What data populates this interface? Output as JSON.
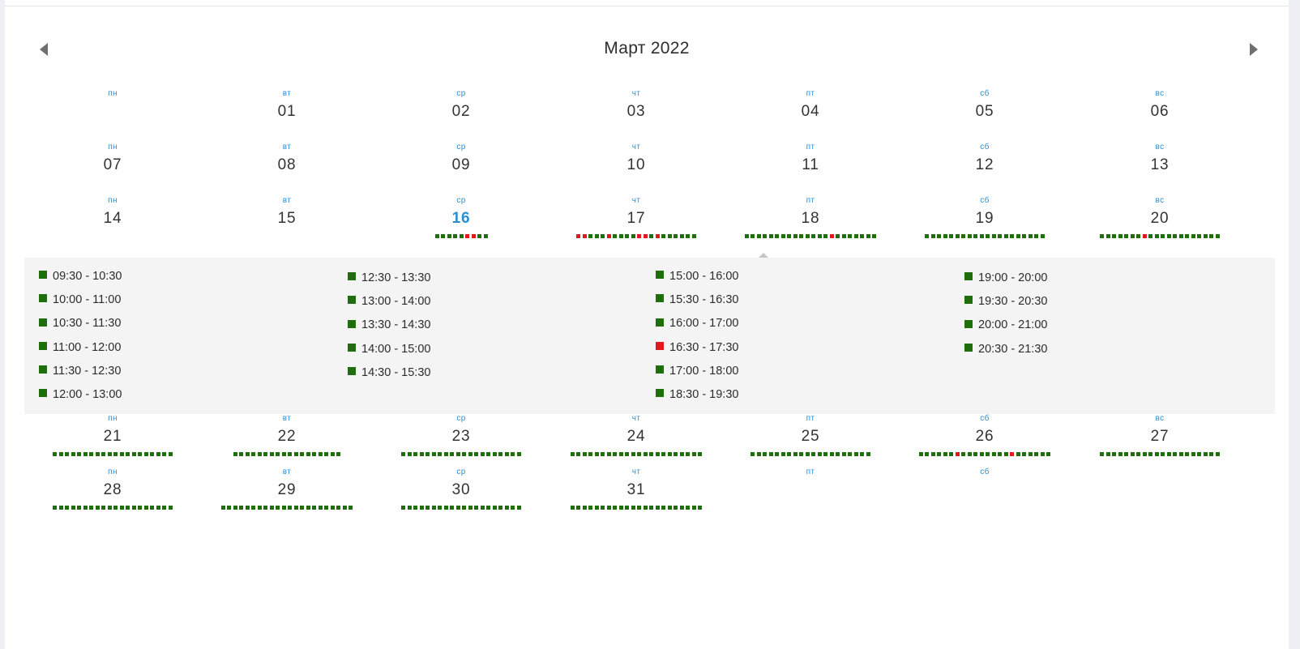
{
  "calendar": {
    "title": "Март 2022",
    "prev_icon": "triangle-left-icon",
    "next_icon": "triangle-right-icon",
    "colors": {
      "available": "#1f6e0c",
      "booked": "#e3181d",
      "weekday": "#2a8ed0",
      "today": "#2a8ed0"
    },
    "weeks": [
      [
        {
          "wd": "пн",
          "day": ""
        },
        {
          "wd": "вт",
          "day": "01"
        },
        {
          "wd": "ср",
          "day": "02"
        },
        {
          "wd": "чт",
          "day": "03"
        },
        {
          "wd": "пт",
          "day": "04"
        },
        {
          "wd": "сб",
          "day": "05"
        },
        {
          "wd": "вс",
          "day": "06"
        }
      ],
      [
        {
          "wd": "пн",
          "day": "07"
        },
        {
          "wd": "вт",
          "day": "08"
        },
        {
          "wd": "ср",
          "day": "09"
        },
        {
          "wd": "чт",
          "day": "10"
        },
        {
          "wd": "пт",
          "day": "11"
        },
        {
          "wd": "сб",
          "day": "12"
        },
        {
          "wd": "вс",
          "day": "13"
        }
      ],
      [
        {
          "wd": "пн",
          "day": "14"
        },
        {
          "wd": "вт",
          "day": "15"
        },
        {
          "wd": "ср",
          "day": "16",
          "today": true,
          "dots": "gggggrrgg"
        },
        {
          "wd": "чт",
          "day": "17",
          "dots": "rrgggrggggrrgrgggggg"
        },
        {
          "wd": "пт",
          "day": "18",
          "dots": "ggggggggggggggrggggggg"
        },
        {
          "wd": "сб",
          "day": "19",
          "dots": "gggggggggggggggggggg"
        },
        {
          "wd": "вс",
          "day": "20",
          "dots": "gggggggrgggggggggggg"
        }
      ],
      [
        {
          "wd": "пн",
          "day": "21",
          "dots": "gggggggggggggggggggg"
        },
        {
          "wd": "вт",
          "day": "22",
          "dots": "gggggggggggggggggg"
        },
        {
          "wd": "ср",
          "day": "23",
          "dots": "gggggggggggggggggggg"
        },
        {
          "wd": "чт",
          "day": "24",
          "dots": "gggggggggggggggggggggg"
        },
        {
          "wd": "пт",
          "day": "25",
          "dots": "gggggggggggggggggggg"
        },
        {
          "wd": "сб",
          "day": "26",
          "dots": "ggggggrggggggggrgggggg"
        },
        {
          "wd": "вс",
          "day": "27",
          "dots": "gggggggggggggggggggg"
        }
      ],
      [
        {
          "wd": "пн",
          "day": "28",
          "dots": "gggggggggggggggggggg"
        },
        {
          "wd": "вт",
          "day": "29",
          "dots": "gggggggggggggggggggggg"
        },
        {
          "wd": "ср",
          "day": "30",
          "dots": "gggggggggggggggggggg"
        },
        {
          "wd": "чт",
          "day": "31",
          "dots": "gggggggggggggggggggggg"
        },
        {
          "wd": "пт",
          "day": ""
        },
        {
          "wd": "сб",
          "day": ""
        }
      ]
    ],
    "time_slots": [
      [
        {
          "time": "09:30 - 10:30",
          "status": "available"
        },
        {
          "time": "10:00 - 11:00",
          "status": "available"
        },
        {
          "time": "10:30 - 11:30",
          "status": "available"
        },
        {
          "time": "11:00 - 12:00",
          "status": "available"
        },
        {
          "time": "11:30 - 12:30",
          "status": "available"
        },
        {
          "time": "12:00 - 13:00",
          "status": "available"
        }
      ],
      [
        {
          "time": "12:30 - 13:30",
          "status": "available"
        },
        {
          "time": "13:00 - 14:00",
          "status": "available"
        },
        {
          "time": "13:30 - 14:30",
          "status": "available"
        },
        {
          "time": "14:00 - 15:00",
          "status": "available"
        },
        {
          "time": "14:30 - 15:30",
          "status": "available"
        }
      ],
      [
        {
          "time": "15:00 - 16:00",
          "status": "available"
        },
        {
          "time": "15:30 - 16:30",
          "status": "available"
        },
        {
          "time": "16:00 - 17:00",
          "status": "available"
        },
        {
          "time": "16:30 - 17:30",
          "status": "booked"
        },
        {
          "time": "17:00 - 18:00",
          "status": "available"
        },
        {
          "time": "18:30 - 19:30",
          "status": "available"
        }
      ],
      [
        {
          "time": "19:00 - 20:00",
          "status": "available"
        },
        {
          "time": "19:30 - 20:30",
          "status": "available"
        },
        {
          "time": "20:00 - 21:00",
          "status": "available"
        },
        {
          "time": "20:30 - 21:30",
          "status": "available"
        }
      ]
    ]
  }
}
